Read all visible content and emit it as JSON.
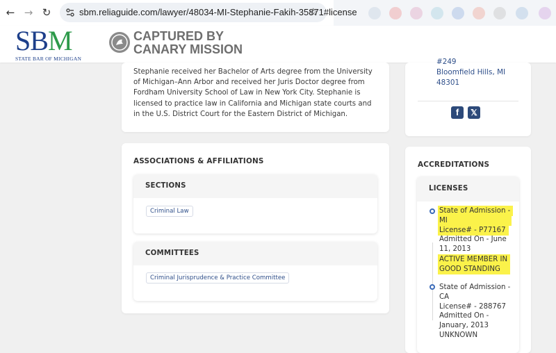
{
  "browser": {
    "url": "sbm.reliaguide.com/lawyer/48034-MI-Stephanie-Fakih-35871#license",
    "back_icon": "←",
    "forward_icon": "→",
    "reload_icon": "↻",
    "star_icon": "☆"
  },
  "header": {
    "logo": {
      "sb": "SB",
      "m": "M",
      "sub": "STATE BAR OF MICHIGAN"
    },
    "watermark_line1": "CAPTURED BY",
    "watermark_line2": "CANARY MISSION"
  },
  "bio": {
    "text": "Stephanie received her Bachelor of Arts degree from the University of Michigan–Ann Arbor and received her Juris Doctor degree from Fordham University School of Law in New York City. Stephanie is licensed to practice law in California and Michigan state courts and in the U.S. District Court for the Eastern District of Michigan."
  },
  "contact": {
    "address_line1": "#249",
    "address_line2": "Bloomfield Hills, MI",
    "address_line3": "48301",
    "facebook": "f",
    "x": "𝕏"
  },
  "associations": {
    "title": "ASSOCIATIONS & AFFILIATIONS",
    "sections": {
      "title": "SECTIONS",
      "tags": [
        "Criminal Law"
      ]
    },
    "committees": {
      "title": "COMMITTEES",
      "tags": [
        "Criminal Jurisprudence & Practice Committee"
      ]
    }
  },
  "accreditations": {
    "title": "ACCREDITATIONS",
    "licenses_title": "LICENSES",
    "licenses": [
      {
        "state_line1": "State of Admission -",
        "state_line2": "MI",
        "license": "License# - P77167",
        "admitted_line1": "Admitted On - June",
        "admitted_line2": "11, 2013",
        "status_line1": "ACTIVE MEMBER IN",
        "status_line2": "GOOD STANDING"
      },
      {
        "state_line1": "State of Admission -",
        "state_line2": "CA",
        "license": "License# - 288767",
        "admitted_line1": "Admitted On -",
        "admitted_line2": "January, 2013",
        "status_line1": "UNKNOWN"
      }
    ]
  },
  "colors": {
    "highlight": "#fbf24a",
    "link_blue": "#2f4f8a",
    "logo_blue": "#1d3f8a",
    "logo_green": "#2d9a4a"
  }
}
